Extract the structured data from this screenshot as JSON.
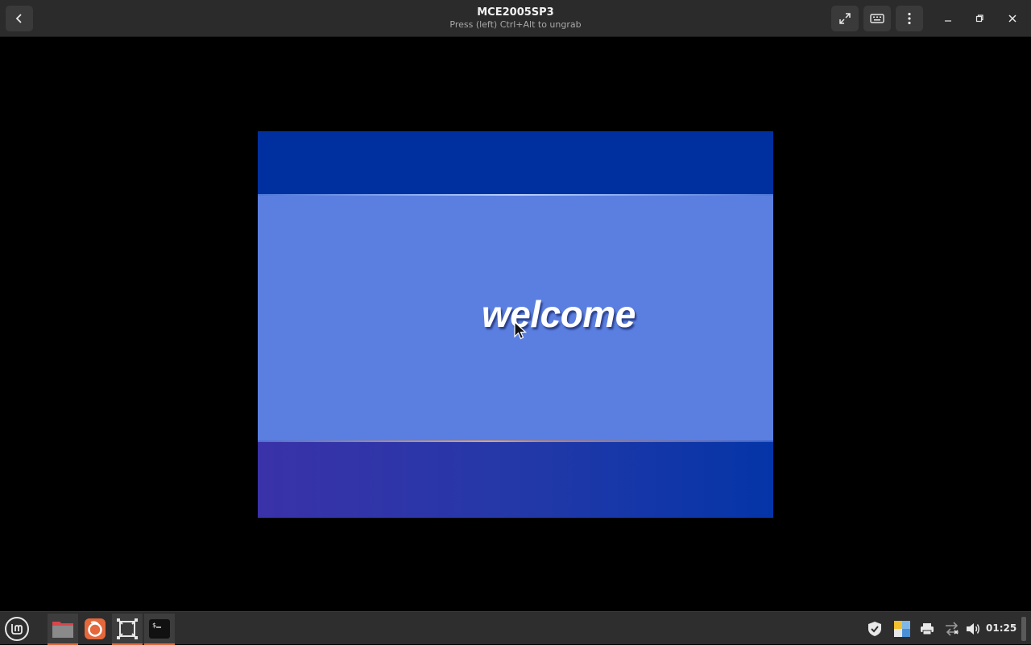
{
  "window": {
    "title": "MCE2005SP3",
    "subtitle": "Press (left) Ctrl+Alt to ungrab"
  },
  "header_buttons": {
    "back": "back-arrow-icon",
    "fullscreen": "fullscreen-icon",
    "keyboard": "keyboard-icon",
    "menu": "kebab-menu-icon",
    "minimize": "minimize-icon",
    "maximize": "maximize-icon",
    "close": "close-icon"
  },
  "vm_screen": {
    "greeting": "welcome",
    "colors": {
      "top_band": "#0030a0",
      "middle_band": "#5b7fe0",
      "bottom_band_left": "#3a32a8",
      "bottom_band_right": "#0435a8"
    }
  },
  "taskbar": {
    "apps": [
      {
        "name": "mint-menu-icon",
        "active": false
      },
      {
        "name": "files-icon",
        "active": true
      },
      {
        "name": "firefox-icon",
        "active": false
      },
      {
        "name": "boxes-icon",
        "active": true
      },
      {
        "name": "terminal-icon",
        "active": true
      }
    ],
    "tray": [
      "shield-icon",
      "update-manager-icon",
      "printer-icon",
      "network-icon",
      "volume-icon"
    ],
    "clock": "01:25",
    "accent_color": "#e4683c"
  }
}
